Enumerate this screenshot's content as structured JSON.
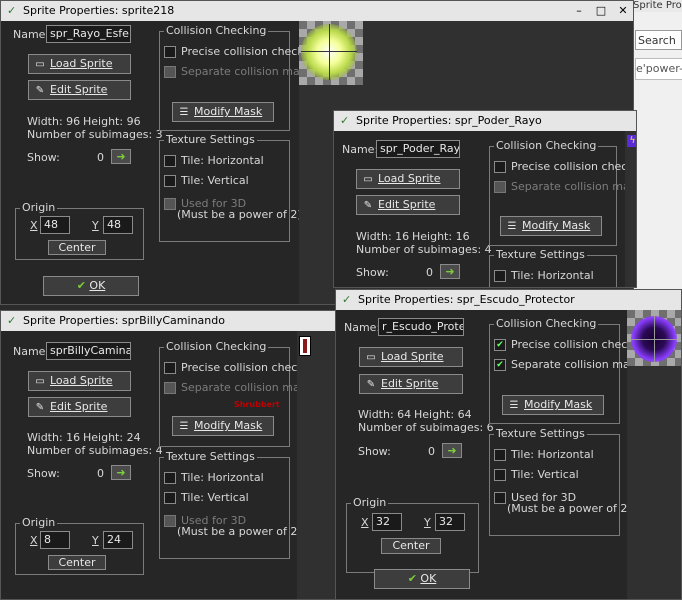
{
  "background_window": {
    "title": "Sprite Prope",
    "search": "Search",
    "url": "e'power-"
  },
  "windows": [
    {
      "title": "Sprite Properties: sprite218",
      "name_label": "Name:",
      "name_value": "spr_Rayo_Esfera",
      "load_label": "Load Sprite",
      "edit_label": "Edit Sprite",
      "width_text": "Width: 96",
      "height_text": "Height: 96",
      "subimages_text": "Number of subimages: 3",
      "show_label": "Show:",
      "show_value": "0",
      "origin_label": "Origin",
      "origin_x_label": "X",
      "origin_x": "48",
      "origin_y_label": "Y",
      "origin_y": "48",
      "center_label": "Center",
      "ok_label": "OK",
      "collision_title": "Collision Checking",
      "precise_label": "Precise collision checking",
      "separate_label": "Separate collision masks",
      "modify_mask_label": "Modify Mask",
      "texture_title": "Texture Settings",
      "tile_h_label": "Tile: Horizontal",
      "tile_v_label": "Tile: Vertical",
      "used3d_label": "Used for 3D",
      "power2_label": "(Must be a power of 2)"
    },
    {
      "title": "Sprite Properties: spr_Poder_Rayo",
      "name_label": "Name:",
      "name_value": "spr_Poder_Rayo_E",
      "load_label": "Load Sprite",
      "edit_label": "Edit Sprite",
      "width_text": "Width: 16",
      "height_text": "Height: 16",
      "subimages_text": "Number of subimages: 4",
      "show_label": "Show:",
      "show_value": "0",
      "collision_title": "Collision Checking",
      "precise_label": "Precise collision checking",
      "separate_label": "Separate collision masks",
      "modify_mask_label": "Modify Mask",
      "texture_title": "Texture Settings",
      "tile_h_label": "Tile: Horizontal"
    },
    {
      "title": "Sprite Properties: sprBillyCaminando",
      "name_label": "Name:",
      "name_value": "sprBillyCaminando",
      "load_label": "Load Sprite",
      "edit_label": "Edit Sprite",
      "width_text": "Width: 16",
      "height_text": "Height: 24",
      "subimages_text": "Number of subimages: 4",
      "show_label": "Show:",
      "show_value": "0",
      "origin_label": "Origin",
      "origin_x_label": "X",
      "origin_x": "8",
      "origin_y_label": "Y",
      "origin_y": "24",
      "center_label": "Center",
      "collision_title": "Collision Checking",
      "precise_label": "Precise collision checking",
      "separate_label": "Separate collision masks",
      "modify_mask_label": "Modify Mask",
      "red_note": "Shrubbert",
      "texture_title": "Texture Settings",
      "tile_h_label": "Tile: Horizontal",
      "tile_v_label": "Tile: Vertical",
      "used3d_label": "Used for 3D",
      "power2_label": "(Must be a power of 2)"
    },
    {
      "title": "Sprite Properties: spr_Escudo_Protector",
      "name_label": "Name:",
      "name_value": "r_Escudo_Protector",
      "load_label": "Load Sprite",
      "edit_label": "Edit Sprite",
      "width_text": "Width: 64",
      "height_text": "Height: 64",
      "subimages_text": "Number of subimages: 6",
      "show_label": "Show:",
      "show_value": "0",
      "origin_label": "Origin",
      "origin_x_label": "X",
      "origin_x": "32",
      "origin_y_label": "Y",
      "origin_y": "32",
      "center_label": "Center",
      "ok_label": "OK",
      "collision_title": "Collision Checking",
      "precise_label": "Precise collision checking",
      "separate_label": "Separate collision masks",
      "modify_mask_label": "Modify Mask",
      "texture_title": "Texture Settings",
      "tile_h_label": "Tile: Horizontal",
      "tile_v_label": "Tile: Vertical",
      "used3d_label": "Used for 3D",
      "power2_label": "(Must be a power of 2)"
    }
  ],
  "colors": {
    "accent_green": "#7ccc3c",
    "dialog_bg": "#262626",
    "orb_yellow": "#f4ff9a",
    "orb_purple": "#8a3cff"
  }
}
